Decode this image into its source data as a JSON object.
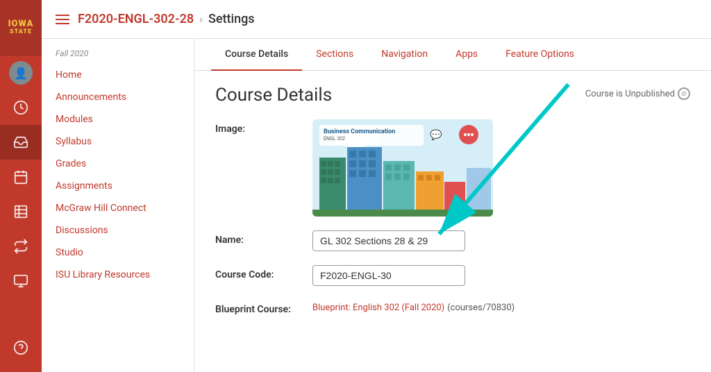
{
  "sidebar": {
    "logo": {
      "iowa": "IOWA",
      "state": "STATE"
    },
    "icons": [
      {
        "name": "avatar-icon",
        "symbol": "👤"
      },
      {
        "name": "clock-icon",
        "symbol": "🕐"
      },
      {
        "name": "inbox-icon",
        "symbol": "📥"
      },
      {
        "name": "calendar-icon",
        "symbol": "📅"
      },
      {
        "name": "gradebook-icon",
        "symbol": "📋"
      },
      {
        "name": "commons-icon",
        "symbol": "🔄"
      },
      {
        "name": "computer-icon",
        "symbol": "🖥"
      },
      {
        "name": "help-icon",
        "symbol": "?"
      }
    ]
  },
  "topbar": {
    "breadcrumb_link": "F2020-ENGL-302-28",
    "breadcrumb_sep": "›",
    "breadcrumb_current": "Settings"
  },
  "left_nav": {
    "semester": "Fall 2020",
    "links": [
      "Home",
      "Announcements",
      "Modules",
      "Syllabus",
      "Grades",
      "Assignments",
      "McGraw Hill Connect",
      "Discussions",
      "Studio",
      "ISU Library Resources"
    ]
  },
  "tabs": [
    {
      "label": "Course Details",
      "active": true
    },
    {
      "label": "Sections",
      "active": false
    },
    {
      "label": "Navigation",
      "active": false
    },
    {
      "label": "Apps",
      "active": false
    },
    {
      "label": "Feature Options",
      "active": false
    }
  ],
  "course_details": {
    "title": "Course Details",
    "unpublished_label": "Course is Unpublished",
    "fields": [
      {
        "label": "Image:",
        "type": "image"
      },
      {
        "label": "Name:",
        "type": "input",
        "value": "GL 302 Sections 28 & 29"
      },
      {
        "label": "Course Code:",
        "type": "input",
        "value": "F2020-ENGL-30"
      },
      {
        "label": "Blueprint Course:",
        "type": "blueprint",
        "link_text": "Blueprint: English 302 (Fall 2020)",
        "extra_text": "(courses/70830)"
      }
    ]
  }
}
